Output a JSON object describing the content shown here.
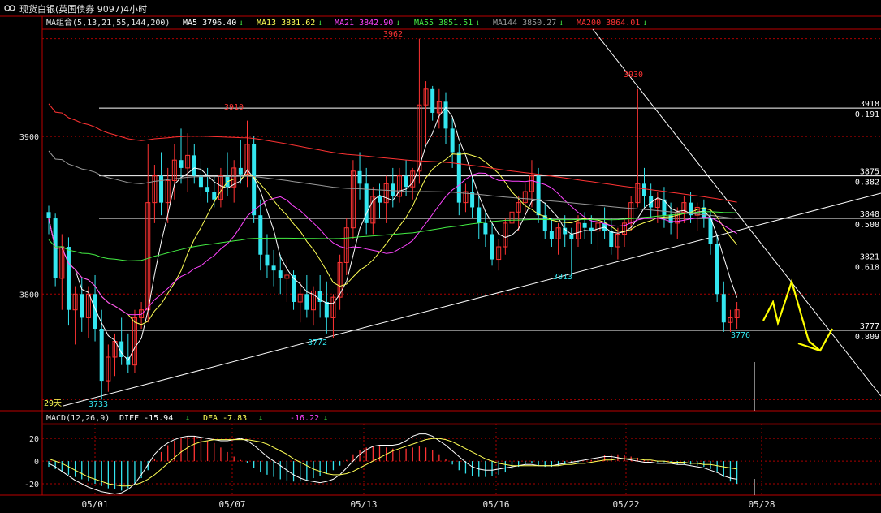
{
  "window": {
    "title": "现货白银(英国债券 9097)4小时"
  },
  "legend": {
    "group_label": "MA组合(5,13,21,55,144,200)",
    "items": [
      {
        "label": "MA5 3796.40",
        "color": "#ffffff"
      },
      {
        "label": "MA13 3831.62",
        "color": "#ffff55"
      },
      {
        "label": "MA21 3842.90",
        "color": "#ff44ff"
      },
      {
        "label": "MA55 3851.51",
        "color": "#44ee44"
      },
      {
        "label": "MA144 3850.27",
        "color": "#9a9a9a"
      },
      {
        "label": "MA200 3864.01",
        "color": "#ff3333"
      }
    ]
  },
  "macd_legend": {
    "label": "MACD(12,26,9)",
    "diff": "DIFF  -15.94",
    "dea": "DEA  -7.83",
    "macd": "-16.22"
  },
  "colors": {
    "up": "#ff3333",
    "down": "#33e6f0",
    "grid_red": "#aa0000",
    "line_white": "#ffffff",
    "arrow_yellow": "#ffff00"
  },
  "chart_data": {
    "type": "candlestick",
    "price_axis": {
      "ticks": [
        3800,
        3900
      ],
      "range": [
        3726,
        3968
      ]
    },
    "macd_axis": {
      "ticks": [
        20,
        0,
        -20
      ],
      "range": [
        -30,
        33
      ]
    },
    "x_labels": [
      "05/01",
      "05/07",
      "05/13",
      "05/16",
      "05/22",
      "05/28"
    ],
    "price_labels": [
      {
        "text": "3962",
        "color": "#ff3333"
      },
      {
        "text": "3930",
        "color": "#ff3333"
      },
      {
        "text": "3910",
        "color": "#ff3333"
      },
      {
        "text": "3813",
        "color": "#33e6f0"
      },
      {
        "text": "3772",
        "color": "#33e6f0"
      },
      {
        "text": "3776",
        "color": "#33e6f0"
      },
      {
        "text": "3733",
        "color": "#33e6f0"
      }
    ],
    "fib_levels": [
      {
        "price": 3918,
        "ratio": "0.191"
      },
      {
        "price": 3875,
        "ratio": "0.382"
      },
      {
        "price": 3848,
        "ratio": "0.500"
      },
      {
        "price": 3821,
        "ratio": "0.618"
      },
      {
        "price": 3777,
        "ratio": "0.809"
      }
    ],
    "period_label": "29天",
    "candles_ohlc": [
      [
        3852,
        3856,
        3838,
        3848
      ],
      [
        3848,
        3851,
        3805,
        3810
      ],
      [
        3810,
        3838,
        3790,
        3830
      ],
      [
        3830,
        3836,
        3780,
        3790
      ],
      [
        3790,
        3805,
        3768,
        3800
      ],
      [
        3800,
        3810,
        3776,
        3785
      ],
      [
        3785,
        3805,
        3772,
        3800
      ],
      [
        3800,
        3812,
        3770,
        3778
      ],
      [
        3778,
        3790,
        3733,
        3745
      ],
      [
        3745,
        3768,
        3738,
        3760
      ],
      [
        3760,
        3775,
        3748,
        3770
      ],
      [
        3770,
        3785,
        3755,
        3760
      ],
      [
        3760,
        3775,
        3750,
        3755
      ],
      [
        3755,
        3790,
        3750,
        3785
      ],
      [
        3785,
        3795,
        3778,
        3790
      ],
      [
        3790,
        3895,
        3782,
        3858
      ],
      [
        3858,
        3882,
        3845,
        3875
      ],
      [
        3875,
        3890,
        3850,
        3858
      ],
      [
        3858,
        3880,
        3845,
        3872
      ],
      [
        3872,
        3895,
        3860,
        3885
      ],
      [
        3885,
        3905,
        3870,
        3880
      ],
      [
        3880,
        3902,
        3865,
        3888
      ],
      [
        3888,
        3895,
        3870,
        3875
      ],
      [
        3875,
        3885,
        3862,
        3868
      ],
      [
        3868,
        3880,
        3858,
        3865
      ],
      [
        3865,
        3875,
        3855,
        3860
      ],
      [
        3860,
        3880,
        3855,
        3875
      ],
      [
        3875,
        3890,
        3862,
        3868
      ],
      [
        3868,
        3885,
        3858,
        3880
      ],
      [
        3880,
        3898,
        3870,
        3876
      ],
      [
        3876,
        3910,
        3868,
        3895
      ],
      [
        3895,
        3900,
        3845,
        3850
      ],
      [
        3850,
        3860,
        3815,
        3825
      ],
      [
        3825,
        3838,
        3810,
        3818
      ],
      [
        3818,
        3828,
        3805,
        3815
      ],
      [
        3815,
        3825,
        3800,
        3810
      ],
      [
        3810,
        3822,
        3795,
        3812
      ],
      [
        3812,
        3815,
        3790,
        3795
      ],
      [
        3795,
        3808,
        3782,
        3800
      ],
      [
        3800,
        3812,
        3785,
        3790
      ],
      [
        3790,
        3805,
        3780,
        3802
      ],
      [
        3802,
        3812,
        3785,
        3795
      ],
      [
        3795,
        3808,
        3775,
        3785
      ],
      [
        3785,
        3800,
        3772,
        3798
      ],
      [
        3798,
        3825,
        3790,
        3820
      ],
      [
        3820,
        3848,
        3812,
        3842
      ],
      [
        3842,
        3885,
        3835,
        3878
      ],
      [
        3878,
        3890,
        3860,
        3870
      ],
      [
        3870,
        3880,
        3838,
        3845
      ],
      [
        3845,
        3868,
        3838,
        3862
      ],
      [
        3862,
        3870,
        3848,
        3858
      ],
      [
        3858,
        3875,
        3845,
        3870
      ],
      [
        3870,
        3880,
        3855,
        3862
      ],
      [
        3862,
        3880,
        3858,
        3875
      ],
      [
        3875,
        3885,
        3862,
        3868
      ],
      [
        3868,
        3880,
        3860,
        3878
      ],
      [
        3878,
        3962,
        3870,
        3920
      ],
      [
        3920,
        3935,
        3895,
        3930
      ],
      [
        3930,
        3932,
        3910,
        3915
      ],
      [
        3915,
        3930,
        3905,
        3922
      ],
      [
        3922,
        3928,
        3895,
        3905
      ],
      [
        3905,
        3912,
        3880,
        3890
      ],
      [
        3890,
        3895,
        3850,
        3858
      ],
      [
        3858,
        3870,
        3852,
        3865
      ],
      [
        3865,
        3875,
        3848,
        3855
      ],
      [
        3855,
        3862,
        3835,
        3845
      ],
      [
        3845,
        3852,
        3830,
        3838
      ],
      [
        3838,
        3845,
        3818,
        3822
      ],
      [
        3822,
        3835,
        3815,
        3830
      ],
      [
        3830,
        3848,
        3825,
        3845
      ],
      [
        3845,
        3858,
        3838,
        3852
      ],
      [
        3852,
        3862,
        3840,
        3858
      ],
      [
        3858,
        3870,
        3850,
        3865
      ],
      [
        3865,
        3885,
        3855,
        3875
      ],
      [
        3875,
        3880,
        3845,
        3850
      ],
      [
        3850,
        3858,
        3835,
        3840
      ],
      [
        3840,
        3848,
        3830,
        3835
      ],
      [
        3835,
        3845,
        3825,
        3842
      ],
      [
        3842,
        3850,
        3830,
        3838
      ],
      [
        3838,
        3842,
        3813,
        3835
      ],
      [
        3835,
        3850,
        3830,
        3845
      ],
      [
        3845,
        3852,
        3835,
        3842
      ],
      [
        3842,
        3850,
        3832,
        3840
      ],
      [
        3840,
        3848,
        3828,
        3845
      ],
      [
        3845,
        3855,
        3835,
        3840
      ],
      [
        3840,
        3848,
        3825,
        3830
      ],
      [
        3830,
        3842,
        3822,
        3838
      ],
      [
        3838,
        3848,
        3830,
        3845
      ],
      [
        3845,
        3862,
        3840,
        3858
      ],
      [
        3858,
        3930,
        3855,
        3870
      ],
      [
        3870,
        3880,
        3855,
        3862
      ],
      [
        3862,
        3870,
        3848,
        3855
      ],
      [
        3855,
        3865,
        3845,
        3860
      ],
      [
        3860,
        3868,
        3842,
        3850
      ],
      [
        3850,
        3858,
        3838,
        3845
      ],
      [
        3845,
        3855,
        3835,
        3852
      ],
      [
        3852,
        3862,
        3845,
        3858
      ],
      [
        3858,
        3865,
        3845,
        3850
      ],
      [
        3850,
        3858,
        3840,
        3855
      ],
      [
        3855,
        3860,
        3842,
        3848
      ],
      [
        3848,
        3852,
        3825,
        3832
      ],
      [
        3832,
        3838,
        3795,
        3800
      ],
      [
        3800,
        3808,
        3776,
        3782
      ],
      [
        3782,
        3790,
        3776,
        3785
      ],
      [
        3785,
        3795,
        3778,
        3790
      ]
    ],
    "macd_hist": [
      -5,
      -7,
      -10,
      -12,
      -14,
      -16,
      -18,
      -20,
      -22,
      -24,
      -25,
      -26,
      -24,
      -20,
      -15,
      -8,
      2,
      8,
      14,
      18,
      20,
      22,
      22,
      20,
      18,
      16,
      12,
      8,
      4,
      1,
      -2,
      -6,
      -10,
      -12,
      -14,
      -16,
      -17,
      -18,
      -18,
      -17,
      -15,
      -13,
      -11,
      -8,
      -4,
      1,
      6,
      10,
      12,
      13,
      13,
      12,
      11,
      10,
      11,
      12,
      13,
      12,
      10,
      6,
      2,
      -3,
      -8,
      -11,
      -13,
      -14,
      -14,
      -13,
      -12,
      -10,
      -7,
      -5,
      -3,
      -2,
      -4,
      -5,
      -5,
      -4,
      -3,
      -2,
      -1,
      0,
      1,
      3,
      5,
      6,
      6,
      5,
      4,
      3,
      1,
      0,
      -1,
      -1,
      -2,
      -3,
      -3,
      -3,
      -4,
      -5,
      -7,
      -10,
      -14,
      -18,
      -20
    ],
    "diff_line": [
      -2,
      -5,
      -9,
      -13,
      -17,
      -20,
      -23,
      -25,
      -27,
      -28,
      -29,
      -28,
      -25,
      -20,
      -12,
      -3,
      6,
      12,
      16,
      19,
      21,
      22,
      22,
      21,
      20,
      19,
      18,
      18,
      19,
      20,
      18,
      14,
      9,
      4,
      0,
      -4,
      -8,
      -12,
      -15,
      -17,
      -18,
      -19,
      -18,
      -16,
      -12,
      -6,
      0,
      6,
      10,
      13,
      14,
      14,
      14,
      15,
      18,
      22,
      24,
      24,
      22,
      18,
      14,
      9,
      4,
      -1,
      -5,
      -7,
      -8,
      -8,
      -7,
      -6,
      -5,
      -4,
      -3,
      -3,
      -4,
      -4,
      -4,
      -3,
      -2,
      -1,
      0,
      1,
      2,
      3,
      4,
      4,
      3,
      2,
      1,
      0,
      -1,
      -1,
      -2,
      -2,
      -2,
      -3,
      -3,
      -4,
      -5,
      -6,
      -8,
      -10,
      -13,
      -15,
      -16
    ],
    "dea_line": [
      2,
      0,
      -2,
      -5,
      -8,
      -11,
      -14,
      -16,
      -18,
      -20,
      -21,
      -22,
      -22,
      -21,
      -19,
      -16,
      -12,
      -7,
      -2,
      3,
      8,
      12,
      15,
      17,
      18,
      19,
      19,
      19,
      19,
      19,
      19,
      18,
      17,
      15,
      12,
      9,
      6,
      2,
      -1,
      -4,
      -7,
      -9,
      -11,
      -12,
      -12,
      -11,
      -9,
      -6,
      -3,
      0,
      3,
      6,
      9,
      11,
      13,
      15,
      17,
      19,
      20,
      20,
      19,
      17,
      14,
      11,
      8,
      5,
      2,
      0,
      -2,
      -3,
      -4,
      -4,
      -4,
      -4,
      -4,
      -4,
      -4,
      -4,
      -3,
      -3,
      -2,
      -2,
      -1,
      0,
      1,
      1,
      2,
      2,
      2,
      2,
      1,
      1,
      0,
      0,
      -1,
      -1,
      -1,
      -2,
      -2,
      -3,
      -3,
      -4,
      -5,
      -6,
      -7
    ]
  }
}
